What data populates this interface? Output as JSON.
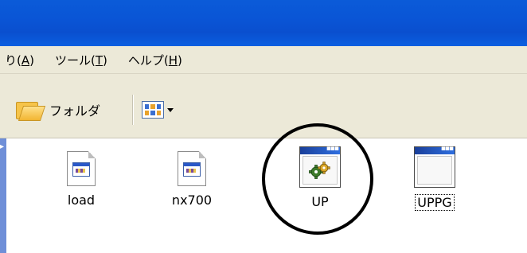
{
  "menubar": {
    "items": [
      {
        "label": "り(",
        "acc": "A",
        "tail": ")"
      },
      {
        "label": "ツール(",
        "acc": "T",
        "tail": ")"
      },
      {
        "label": "ヘルプ(",
        "acc": "H",
        "tail": ")"
      }
    ]
  },
  "toolbar": {
    "folders_label": "フォルダ"
  },
  "files": [
    {
      "name": "load",
      "icon": "exe-document-icon"
    },
    {
      "name": "nx700",
      "icon": "exe-document-icon"
    },
    {
      "name": "UP",
      "icon": "gear-app-icon"
    },
    {
      "name": "UPPG",
      "icon": "window-app-icon",
      "focused": true
    }
  ]
}
